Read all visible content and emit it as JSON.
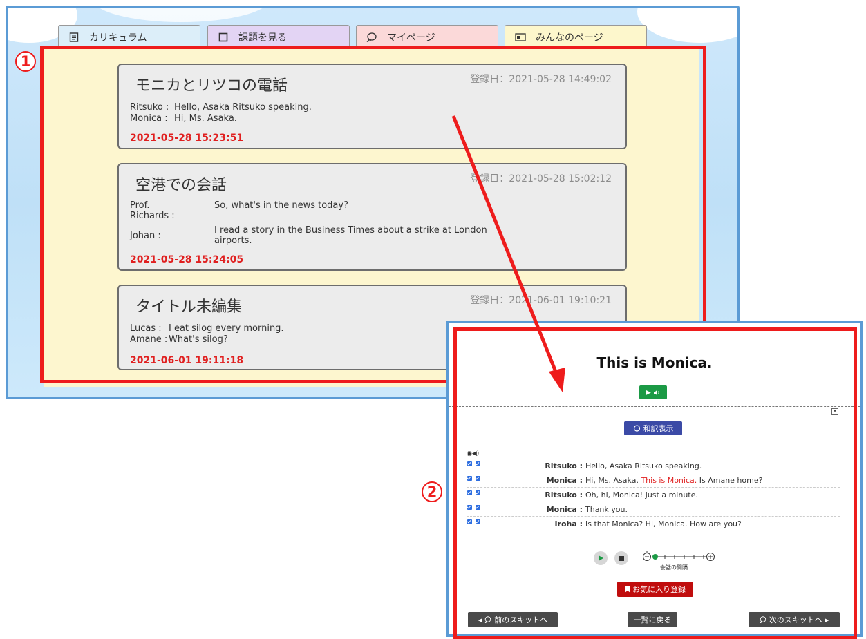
{
  "tabs": [
    {
      "label": "カリキュラム",
      "icon": "document-icon"
    },
    {
      "label": "課題を見る",
      "icon": "square-icon"
    },
    {
      "label": "マイページ",
      "icon": "chat-icon"
    },
    {
      "label": "みんなのページ",
      "icon": "board-icon"
    }
  ],
  "badges": {
    "one": "1",
    "two": "2"
  },
  "cards": [
    {
      "title": "モニカとリツコの電話",
      "registered": "登録日：2021-05-28 14:49:02",
      "lines": [
        {
          "speaker": "Ritsuko :",
          "text": "Hello, Asaka Ritsuko speaking."
        },
        {
          "speaker": "Monica :",
          "text": "Hi, Ms. Asaka."
        }
      ],
      "timestamp": "2021-05-28 15:23:51"
    },
    {
      "title": "空港での会話",
      "registered": "登録日：2021-05-28 15:02:12",
      "lines": [
        {
          "speaker": "Prof. Richards :",
          "text": "So, what's in the news today?"
        },
        {
          "speaker": "Johan :",
          "text": "I read a story in the Business Times about a strike at London airports."
        }
      ],
      "timestamp": "2021-05-28 15:24:05"
    },
    {
      "title": "タイトル未編集",
      "registered": "登録日：2021-06-01 19:10:21",
      "lines": [
        {
          "speaker": "Lucas :",
          "text": "I eat silog every morning."
        },
        {
          "speaker": "Amane :",
          "text": "What's silog?"
        }
      ],
      "timestamp": "2021-06-01 19:11:18"
    }
  ],
  "detail": {
    "title": "This is Monica.",
    "translate_label": "和訳表示",
    "rows": [
      {
        "speaker": "Ritsuko :",
        "pre": "Hello, Asaka Ritsuko speaking.",
        "highlight": "",
        "post": ""
      },
      {
        "speaker": "Monica :",
        "pre": "Hi, Ms. Asaka. ",
        "highlight": "This is Monica.",
        "post": " Is Amane home?"
      },
      {
        "speaker": "Ritsuko :",
        "pre": "Oh, hi, Monica! Just a minute.",
        "highlight": "",
        "post": ""
      },
      {
        "speaker": "Monica :",
        "pre": "Thank you.",
        "highlight": "",
        "post": ""
      },
      {
        "speaker": "Iroha :",
        "pre": "Is that Monica? Hi, Monica. How are you?",
        "highlight": "",
        "post": ""
      }
    ],
    "interval_label": "会話の間隔",
    "interval_level": 0.0,
    "favorite_label": "お気に入り登録",
    "prev_label": "前のスキットへ",
    "list_label": "一覧に戻る",
    "next_label": "次のスキットへ"
  },
  "colors": {
    "highlight": "#ee1c1c",
    "accent_green": "#1b9a45",
    "accent_blue": "#3b4aa6"
  }
}
